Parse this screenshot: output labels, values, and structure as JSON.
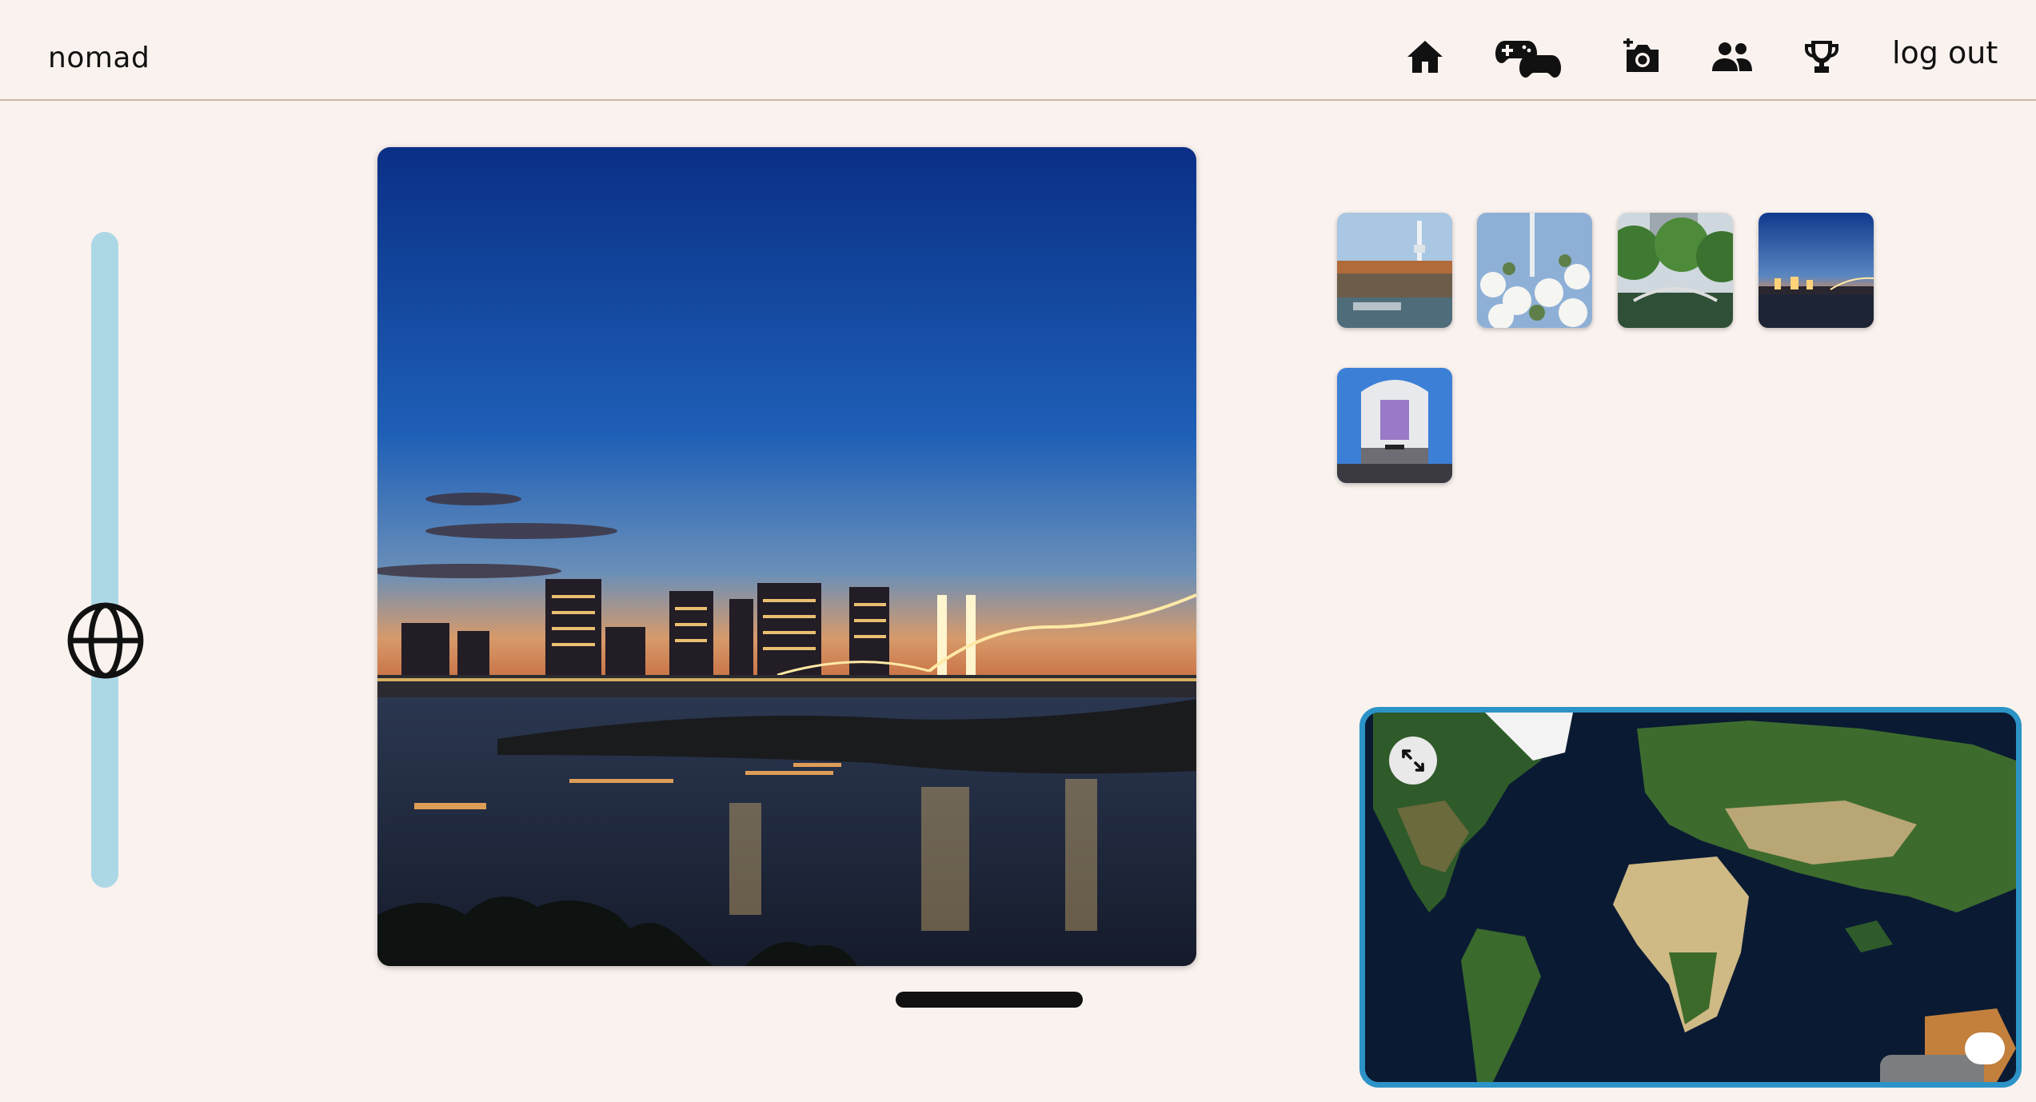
{
  "header": {
    "brand": "nomad",
    "nav": [
      {
        "icon": "home-icon"
      },
      {
        "icon": "gamepad-icon"
      },
      {
        "icon": "add-photo-icon"
      },
      {
        "icon": "friends-icon"
      },
      {
        "icon": "trophy-icon"
      }
    ],
    "logout_label": "log out"
  },
  "slider": {
    "icon": "globe-icon",
    "track_color": "#acd8e6"
  },
  "main_photo": {
    "description_icon": "photo"
  },
  "thumbnails": [
    "tokyo-skytree-river",
    "skytree-blossoms",
    "park-bridge",
    "rainbow-bridge-night",
    "shibuya-modi"
  ],
  "map": {
    "expand_icon": "expand-icon",
    "border_color": "#2c93c7"
  },
  "colors": {
    "background": "#faf2ee",
    "accent": "#2c93c7"
  }
}
